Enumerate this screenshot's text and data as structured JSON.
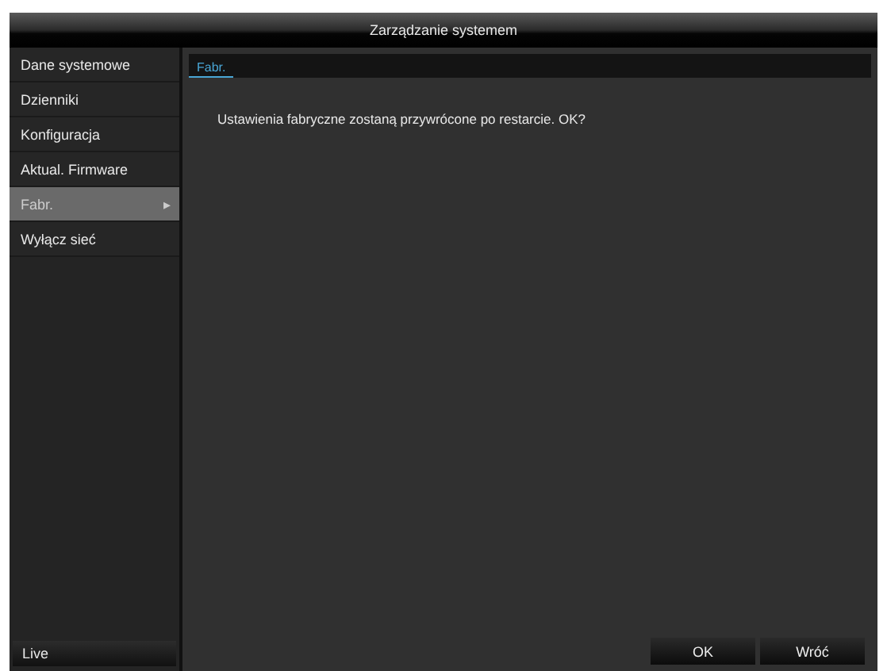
{
  "window": {
    "title": "Zarządzanie systemem"
  },
  "sidebar": {
    "items": [
      {
        "label": "Dane systemowe",
        "selected": false
      },
      {
        "label": "Dzienniki",
        "selected": false
      },
      {
        "label": "Konfiguracja",
        "selected": false
      },
      {
        "label": "Aktual. Firmware",
        "selected": false
      },
      {
        "label": "Fabr.",
        "selected": true,
        "arrow": "▸"
      },
      {
        "label": "Wyłącz sieć",
        "selected": false
      }
    ],
    "footer": "Live"
  },
  "tabs": [
    {
      "label": "Fabr.",
      "selected": true
    }
  ],
  "message": "Ustawienia fabryczne zostaną przywrócone po restarcie. OK?",
  "buttons": [
    "OK",
    "Wróć"
  ]
}
